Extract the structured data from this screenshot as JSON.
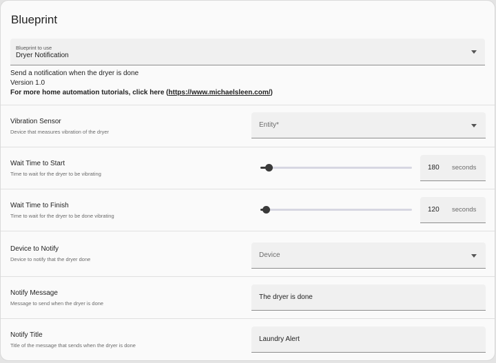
{
  "title": "Blueprint",
  "blueprint_select": {
    "label": "Blueprint to use",
    "value": "Dryer Notification"
  },
  "description": {
    "line1": "Send a notification when the dryer is done",
    "line2": "Version 1.0",
    "tutorials_prefix": "For more home automation tutorials, click here (",
    "tutorials_link": "https://www.michaelsleen.com/",
    "tutorials_suffix": ")"
  },
  "inputs": {
    "vibration_sensor": {
      "name": "Vibration Sensor",
      "description": "Device that measures vibration of the dryer",
      "placeholder": "Entity*"
    },
    "wait_start": {
      "name": "Wait Time to Start",
      "description": "Time to wait for the dryer to be vibrating",
      "value": "180",
      "unit": "seconds",
      "slider_fraction": 0.055
    },
    "wait_finish": {
      "name": "Wait Time to Finish",
      "description": "Time to wait for the dryer to be done vibrating",
      "value": "120",
      "unit": "seconds",
      "slider_fraction": 0.035
    },
    "notify_device": {
      "name": "Device to Notify",
      "description": "Device to notify that the dryer done",
      "placeholder": "Device"
    },
    "notify_message": {
      "name": "Notify Message",
      "description": "Message to send when the dryer is done",
      "value": "The dryer is done"
    },
    "notify_title": {
      "name": "Notify Title",
      "description": "Title of the message that sends when the dryer is done",
      "value": "Laundry Alert"
    }
  }
}
